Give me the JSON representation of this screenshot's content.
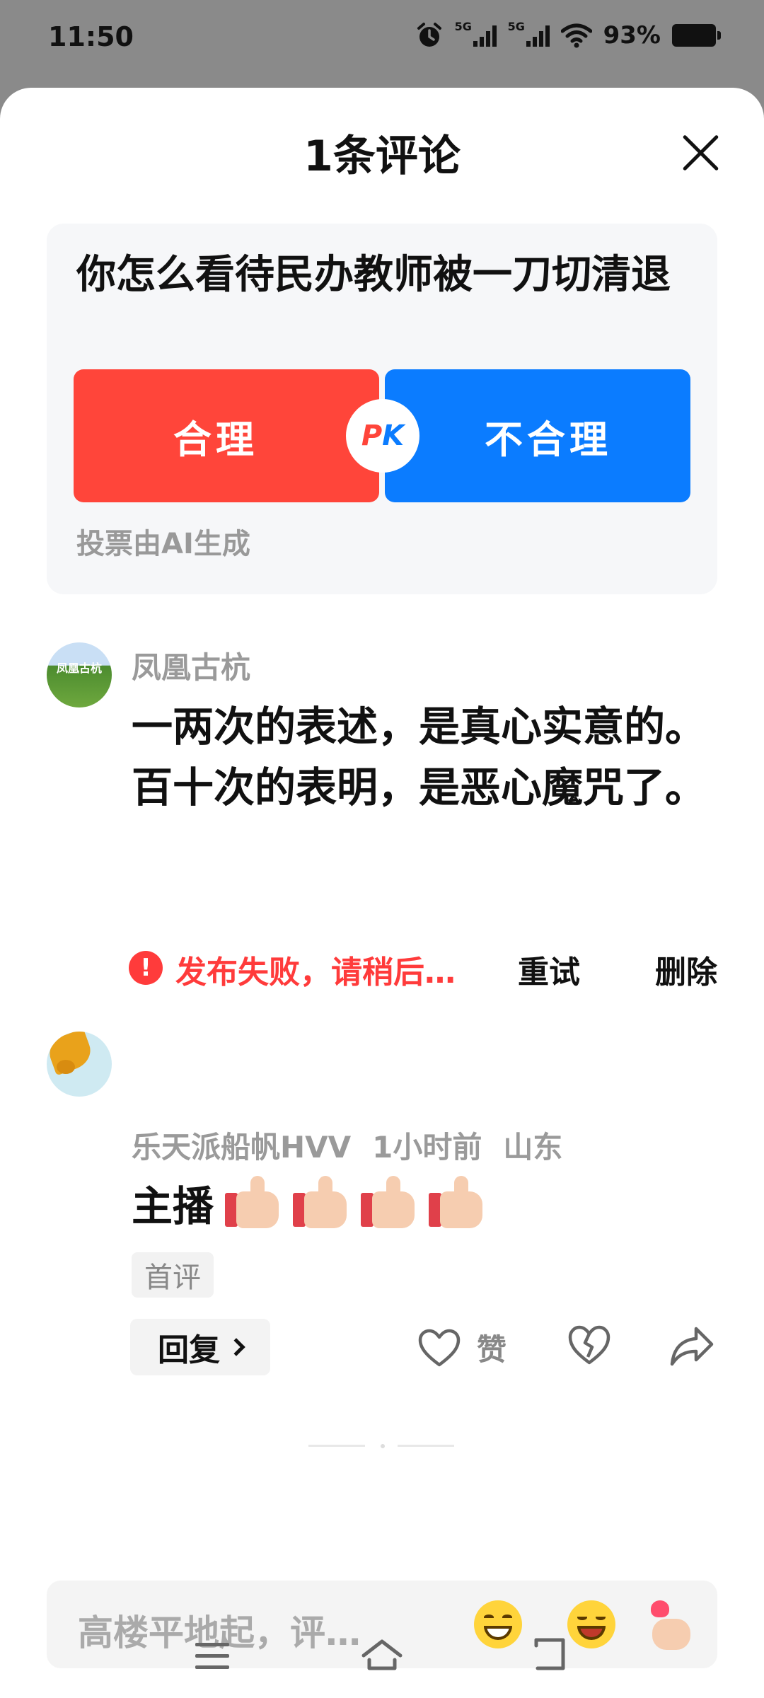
{
  "status_bar": {
    "time": "11:50",
    "signal_1": "5G",
    "signal_2": "5G",
    "battery": "93%"
  },
  "sheet": {
    "title": "1条评论"
  },
  "vote": {
    "question": "你怎么看待民办教师被一刀切清退",
    "option_yes": "合理",
    "option_no": "不合理",
    "pk": {
      "p": "P",
      "k": "K"
    },
    "note": "投票由AI生成",
    "colors": {
      "yes": "#ff453a",
      "no": "#0b7cff"
    }
  },
  "comments": [
    {
      "author": "凤凰古杭",
      "avatar_text": "凤凰古杭",
      "lines": [
        "一两次的表述，是真心实意的。",
        "百十次的表明，是恶心魔咒了。"
      ],
      "status": "发布失败，请稍后…",
      "retry_label": "重试",
      "delete_label": "删除"
    },
    {
      "author": "乐天派船帆HVV",
      "time": "1小时前",
      "location": "山东",
      "text": "主播",
      "emoji_count": 4,
      "emoji": "thumbs-up",
      "badge": "首评",
      "reply_label": "回复",
      "like_label": "赞"
    }
  ],
  "input": {
    "placeholder": "高楼平地起，评…",
    "emojis": [
      "grinning-face-icon",
      "laughing-face-icon",
      "finger-heart-icon"
    ]
  },
  "accent_red": "#ff3b3b"
}
